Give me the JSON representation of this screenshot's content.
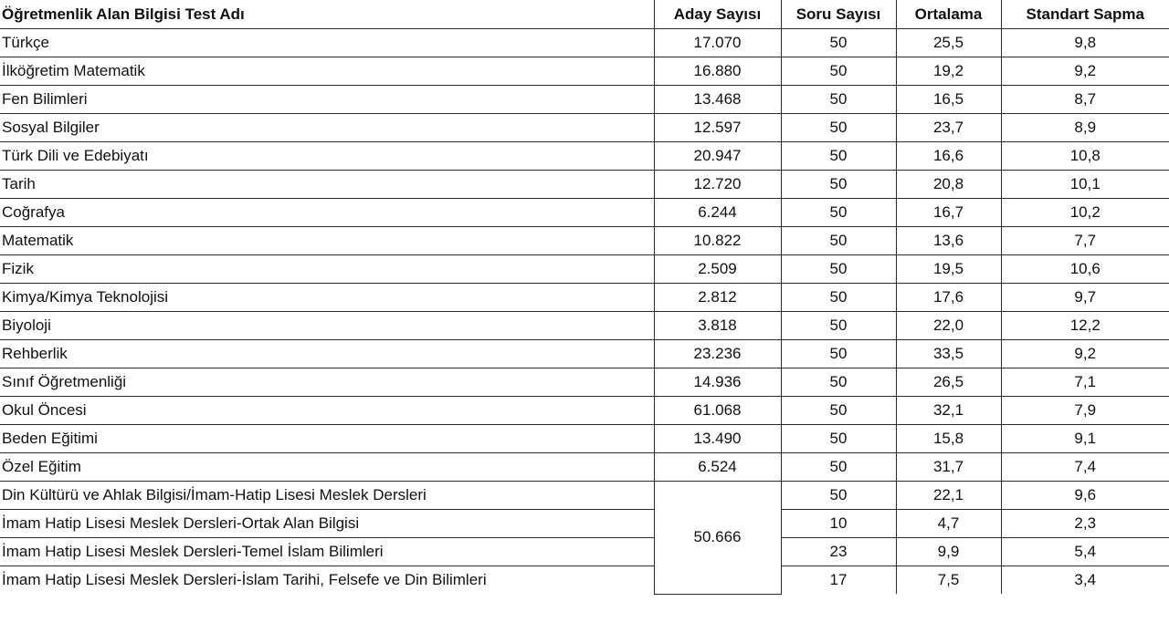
{
  "table": {
    "headers": [
      "Öğretmenlik Alan Bilgisi Test Adı",
      "Aday Sayısı",
      "Soru Sayısı",
      "Ortalama",
      "Standart Sapma"
    ],
    "rows": [
      {
        "name": "Türkçe",
        "aday": "17.070",
        "soru": "50",
        "ortalama": "25,5",
        "sapma": "9,8"
      },
      {
        "name": "İlköğretim Matematik",
        "aday": "16.880",
        "soru": "50",
        "ortalama": "19,2",
        "sapma": "9,2"
      },
      {
        "name": "Fen Bilimleri",
        "aday": "13.468",
        "soru": "50",
        "ortalama": "16,5",
        "sapma": "8,7"
      },
      {
        "name": "Sosyal Bilgiler",
        "aday": "12.597",
        "soru": "50",
        "ortalama": "23,7",
        "sapma": "8,9"
      },
      {
        "name": "Türk Dili ve Edebiyatı",
        "aday": "20.947",
        "soru": "50",
        "ortalama": "16,6",
        "sapma": "10,8"
      },
      {
        "name": "Tarih",
        "aday": "12.720",
        "soru": "50",
        "ortalama": "20,8",
        "sapma": "10,1"
      },
      {
        "name": "Coğrafya",
        "aday": "6.244",
        "soru": "50",
        "ortalama": "16,7",
        "sapma": "10,2"
      },
      {
        "name": "Matematik",
        "aday": "10.822",
        "soru": "50",
        "ortalama": "13,6",
        "sapma": "7,7"
      },
      {
        "name": "Fizik",
        "aday": "2.509",
        "soru": "50",
        "ortalama": "19,5",
        "sapma": "10,6"
      },
      {
        "name": "Kimya/Kimya Teknolojisi",
        "aday": "2.812",
        "soru": "50",
        "ortalama": "17,6",
        "sapma": "9,7"
      },
      {
        "name": "Biyoloji",
        "aday": "3.818",
        "soru": "50",
        "ortalama": "22,0",
        "sapma": "12,2"
      },
      {
        "name": "Rehberlik",
        "aday": "23.236",
        "soru": "50",
        "ortalama": "33,5",
        "sapma": "9,2"
      },
      {
        "name": "Sınıf Öğretmenliği",
        "aday": "14.936",
        "soru": "50",
        "ortalama": "26,5",
        "sapma": "7,1"
      },
      {
        "name": "Okul Öncesi",
        "aday": "61.068",
        "soru": "50",
        "ortalama": "32,1",
        "sapma": "7,9"
      },
      {
        "name": "Beden Eğitimi",
        "aday": "13.490",
        "soru": "50",
        "ortalama": "15,8",
        "sapma": "9,1"
      },
      {
        "name": "Özel Eğitim",
        "aday": "6.524",
        "soru": "50",
        "ortalama": "31,7",
        "sapma": "7,4"
      }
    ],
    "group": {
      "aday": "50.666",
      "rows": [
        {
          "name": "Din Kültürü ve Ahlak Bilgisi/İmam-Hatip Lisesi Meslek Dersleri",
          "soru": "50",
          "ortalama": "22,1",
          "sapma": "9,6"
        },
        {
          "name": "İmam Hatip Lisesi Meslek Dersleri-Ortak Alan Bilgisi",
          "soru": "10",
          "ortalama": "4,7",
          "sapma": "2,3"
        },
        {
          "name": "İmam Hatip Lisesi Meslek Dersleri-Temel İslam Bilimleri",
          "soru": "23",
          "ortalama": "9,9",
          "sapma": "5,4"
        },
        {
          "name": "İmam Hatip Lisesi Meslek Dersleri-İslam Tarihi, Felsefe ve Din Bilimleri",
          "soru": "17",
          "ortalama": "7,5",
          "sapma": "3,4"
        }
      ]
    }
  }
}
